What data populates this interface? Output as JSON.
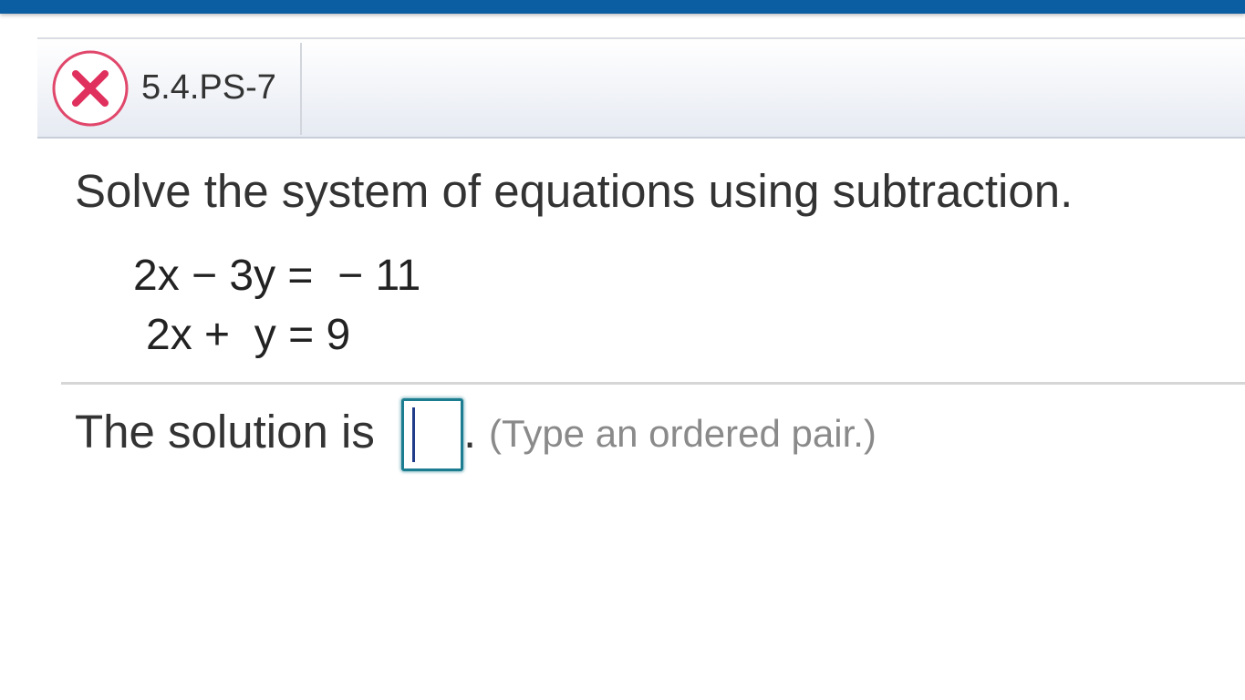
{
  "header": {
    "question_id": "5.4.PS-7",
    "status_icon": "incorrect-x-icon",
    "status_color": "#e0476b"
  },
  "question": {
    "instruction": "Solve the system of equations using subtraction.",
    "equations": [
      "2x − 3y =  − 11",
      "2x +  y = 9"
    ]
  },
  "answer": {
    "prefix": "The solution is",
    "input_value": "",
    "period": ".",
    "hint": "(Type an ordered pair.)"
  },
  "colors": {
    "top_bar": "#0b5ea2",
    "input_border": "#1b7d8f",
    "hint_text": "#8a8a8a"
  }
}
